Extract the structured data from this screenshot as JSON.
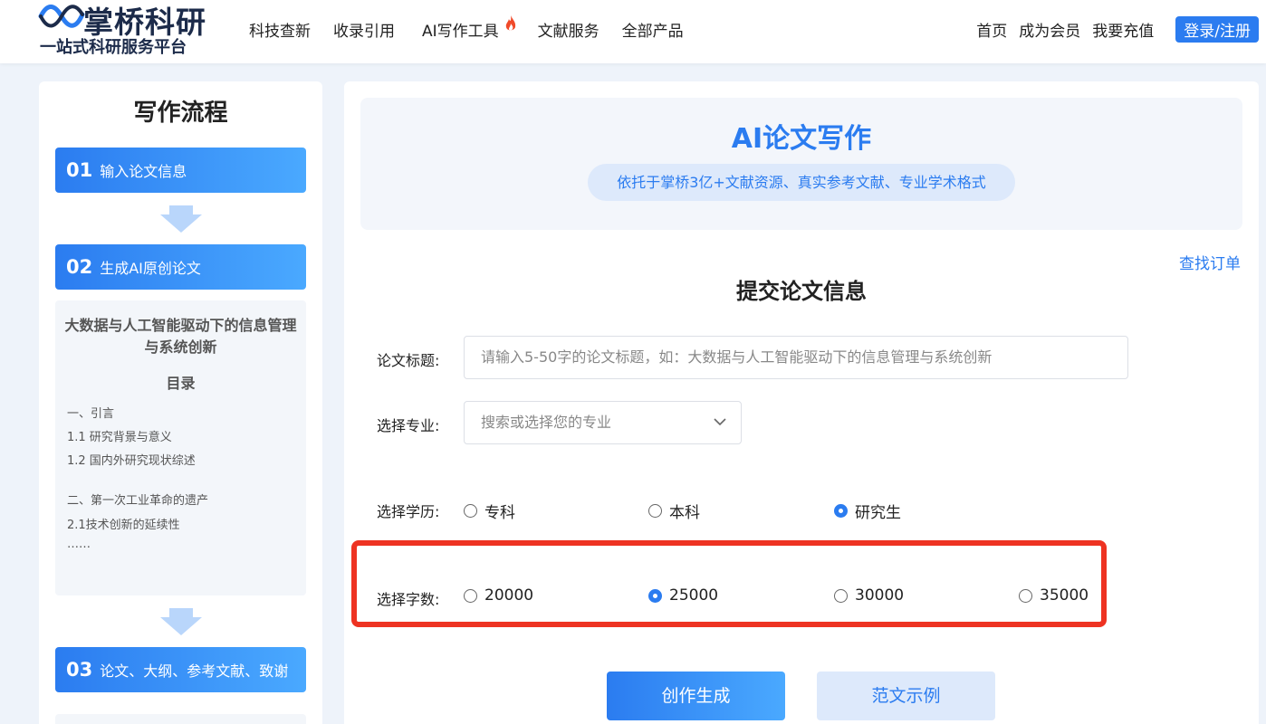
{
  "header": {
    "logo_name": "掌桥科研",
    "logo_slogan": "一站式科研服务平台",
    "nav": [
      "科技查新",
      "收录引用",
      "AI写作工具",
      "文献服务",
      "全部产品"
    ],
    "right_links": [
      "首页",
      "成为会员",
      "我要充值"
    ],
    "login_label": "登录/注册"
  },
  "sidebar": {
    "title": "写作流程",
    "steps": [
      {
        "num": "01",
        "label": "输入论文信息"
      },
      {
        "num": "02",
        "label": "生成AI原创论文"
      },
      {
        "num": "03",
        "label": "论文、大纲、参考文献、致谢"
      }
    ],
    "preview": {
      "title": "大数据与人工智能驱动下的信息管理与系统创新",
      "toc_heading": "目录",
      "lines": [
        "一、引言",
        "1.1 研究背景与意义",
        "1.2 国内外研究现状综述",
        "二、第一次工业革命的遗产",
        "2.1技术创新的延续性",
        "……"
      ]
    }
  },
  "main": {
    "banner_title": "AI论文写作",
    "banner_subtitle": "依托于掌桥3亿+文献资源、真实参考文献、专业学术格式",
    "find_order": "查找订单",
    "form_title": "提交论文信息",
    "title_label": "论文标题:",
    "title_placeholder": "请输入5-50字的论文标题，如：大数据与人工智能驱动下的信息管理与系统创新",
    "major_label": "选择专业:",
    "major_placeholder": "搜索或选择您的专业",
    "degree_label": "选择学历:",
    "degree_options": [
      "专科",
      "本科",
      "研究生"
    ],
    "degree_selected": "研究生",
    "words_label": "选择字数:",
    "word_options": [
      "20000",
      "25000",
      "30000",
      "35000"
    ],
    "words_selected": "25000",
    "create_button": "创作生成",
    "sample_button": "范文示例"
  },
  "colors": {
    "accent": "#2b7cf0",
    "highlight": "#ee3322"
  }
}
